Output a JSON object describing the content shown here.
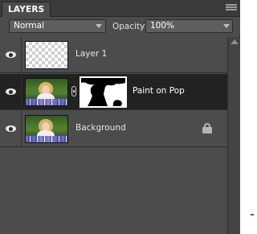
{
  "panel": {
    "tab_label": "LAYERS",
    "menu_icon": "panel-menu-icon"
  },
  "options": {
    "blend_mode": "Normal",
    "opacity_label": "Opacity:",
    "opacity_value": "100%"
  },
  "layers": [
    {
      "name": "Layer 1",
      "visible": true,
      "thumbnail": "transparent",
      "selected": false,
      "has_mask": false,
      "locked": false
    },
    {
      "name": "Paint on Pop",
      "visible": true,
      "thumbnail": "photo",
      "selected": true,
      "has_mask": true,
      "locked": false
    },
    {
      "name": "Background",
      "visible": true,
      "thumbnail": "photo",
      "selected": false,
      "has_mask": false,
      "locked": true
    }
  ],
  "icons": {
    "visibility": "eye-icon",
    "link": "chain-link-icon",
    "lock": "lock-icon",
    "dropdown": "chevron-down-icon",
    "scroll_up": "scroll-up-arrow-icon"
  },
  "colors": {
    "panel_bg": "#4c4c4c",
    "selected_row_bg": "#222222",
    "text": "#e6e6e6"
  }
}
